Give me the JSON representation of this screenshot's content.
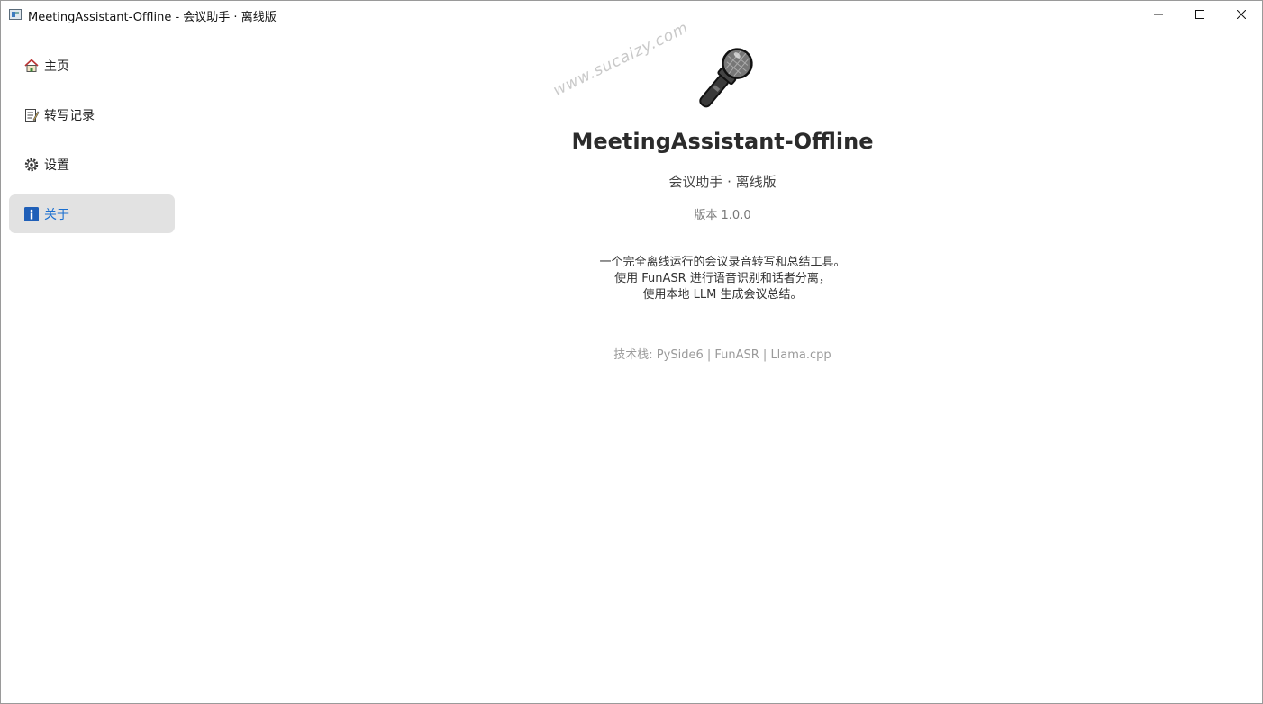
{
  "window": {
    "title": "MeetingAssistant-Offline - 会议助手 · 离线版"
  },
  "sidebar": {
    "items": [
      {
        "label": "主页",
        "icon": "house-icon"
      },
      {
        "label": "转写记录",
        "icon": "memo-icon"
      },
      {
        "label": "设置",
        "icon": "gear-icon"
      },
      {
        "label": "关于",
        "icon": "info-icon",
        "active": true
      }
    ]
  },
  "about": {
    "icon": "microphone-icon",
    "watermark": "www.sucaizy.com",
    "app_name": "MeetingAssistant-Offline",
    "subtitle": "会议助手 · 离线版",
    "version": "版本 1.0.0",
    "description": [
      "一个完全离线运行的会议录音转写和总结工具。",
      "使用 FunASR 进行语音识别和话者分离，",
      "使用本地 LLM 生成会议总结。"
    ],
    "tech_stack": "技术栈: PySide6 | FunASR | Llama.cpp"
  },
  "colors": {
    "accent": "#1a6fd0",
    "active_bg": "#e2e2e2",
    "info_icon_bg": "#1f5fb8"
  }
}
